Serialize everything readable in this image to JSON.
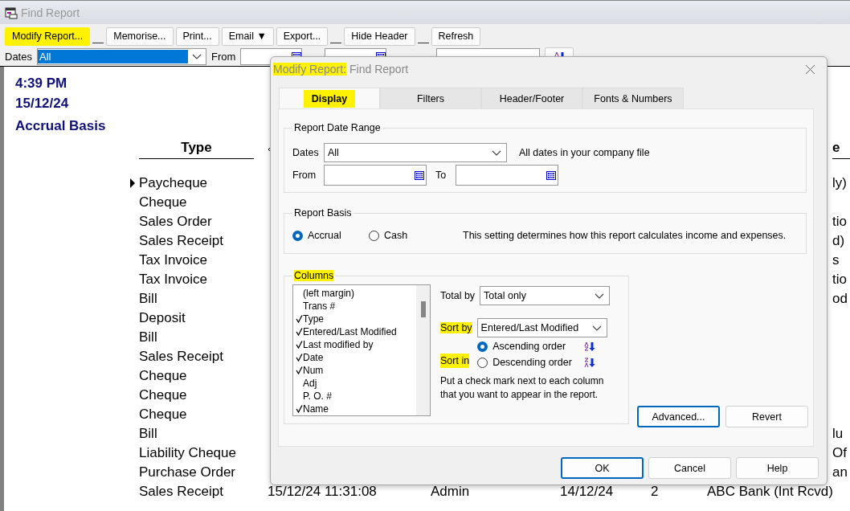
{
  "window": {
    "title": "Find Report"
  },
  "toolbar": [
    {
      "label": "Modify Report...",
      "highlighted": true
    },
    {
      "label": "Memorise...",
      "highlighted": false
    },
    {
      "label": "Print...",
      "highlighted": false
    },
    {
      "label": "Email",
      "caret": "▼",
      "highlighted": false
    },
    {
      "label": "Export...",
      "highlighted": false
    },
    {
      "label": "Hide Header",
      "highlighted": false
    },
    {
      "label": "Refresh",
      "highlighted": false
    }
  ],
  "filter_bar": {
    "dates_label": "Dates",
    "dates_value": "All",
    "from_label": "From"
  },
  "report": {
    "time": "4:39 PM",
    "date": "15/12/24",
    "basis": "Accrual Basis",
    "type_header": "Type",
    "last_header": "e",
    "rows": [
      {
        "type": "Paycheque",
        "current": true,
        "tail": "ly)"
      },
      {
        "type": "Cheque",
        "current": false
      },
      {
        "type": "Sales Order",
        "current": false,
        "tail": "tio"
      },
      {
        "type": "Sales Receipt",
        "current": false,
        "tail": "d)"
      },
      {
        "type": "Tax Invoice",
        "current": false,
        "tail": "s"
      },
      {
        "type": "Tax Invoice",
        "current": false,
        "tail": "tio"
      },
      {
        "type": "Bill",
        "current": false,
        "tail": "od"
      },
      {
        "type": "Deposit",
        "current": false
      },
      {
        "type": "Bill",
        "current": false
      },
      {
        "type": "Sales Receipt",
        "current": false
      },
      {
        "type": "Cheque",
        "current": false
      },
      {
        "type": "Cheque",
        "current": false
      },
      {
        "type": "Cheque",
        "current": false
      },
      {
        "type": "Bill",
        "current": false,
        "tail": "lu"
      },
      {
        "type": "Liability Cheque",
        "current": false,
        "tail": "Of"
      },
      {
        "type": "Purchase Order",
        "current": false,
        "tail": "an"
      },
      {
        "type": "Sales Receipt",
        "current": false,
        "cells": [
          "15/12/24 11:31:08",
          "Admin",
          "14/12/24",
          "2",
          "ABC Bank (Int Rcvd)"
        ]
      }
    ]
  },
  "dialog": {
    "title_highlight": "Modify Report:",
    "title": "Find Report",
    "tabs": [
      {
        "label": "Display",
        "selected": true,
        "highlighted": true
      },
      {
        "label": "Filters",
        "selected": false,
        "highlighted": false
      },
      {
        "label": "Header/Footer",
        "selected": false,
        "highlighted": false
      },
      {
        "label": "Fonts & Numbers",
        "selected": false,
        "highlighted": false
      }
    ],
    "date_range": {
      "legend": "Report Date Range",
      "dates_label": "Dates",
      "dates_value": "All",
      "dates_note": "All dates in your company file",
      "from_label": "From",
      "to_label": "To"
    },
    "basis": {
      "legend": "Report Basis",
      "options": [
        {
          "label": "Accrual",
          "selected": true
        },
        {
          "label": "Cash",
          "selected": false
        }
      ],
      "note": "This setting determines how this report calculates income and expenses."
    },
    "columns": {
      "legend": "Columns",
      "highlighted": true,
      "items": [
        {
          "label": "(left margin)",
          "checked": false
        },
        {
          "label": "Trans #",
          "checked": false
        },
        {
          "label": "Type",
          "checked": true
        },
        {
          "label": "Entered/Last Modified",
          "checked": true
        },
        {
          "label": "Last modified by",
          "checked": true
        },
        {
          "label": "Date",
          "checked": true
        },
        {
          "label": "Num",
          "checked": true
        },
        {
          "label": "Adj",
          "checked": false
        },
        {
          "label": "P. O. #",
          "checked": false
        },
        {
          "label": "Name",
          "checked": true
        }
      ],
      "total_by_label": "Total by",
      "total_by_value": "Total only",
      "sort_by_label": "Sort by",
      "sort_by_highlighted": true,
      "sort_by_value": "Entered/Last Modified",
      "sort_in_label": "Sort in",
      "sort_in_highlighted": true,
      "sort_orders": [
        {
          "label": "Ascending order",
          "selected": true,
          "kind": "ascending"
        },
        {
          "label": "Descending order",
          "selected": false,
          "kind": "descending"
        }
      ],
      "hint": "Put a check mark next to each column that you want to appear in the report."
    },
    "side_buttons": [
      {
        "label": "Advanced...",
        "focused": true
      },
      {
        "label": "Revert",
        "focused": false
      }
    ],
    "footer_buttons": [
      {
        "label": "OK",
        "focused": true
      },
      {
        "label": "Cancel",
        "focused": false
      },
      {
        "label": "Help",
        "focused": false
      }
    ]
  }
}
